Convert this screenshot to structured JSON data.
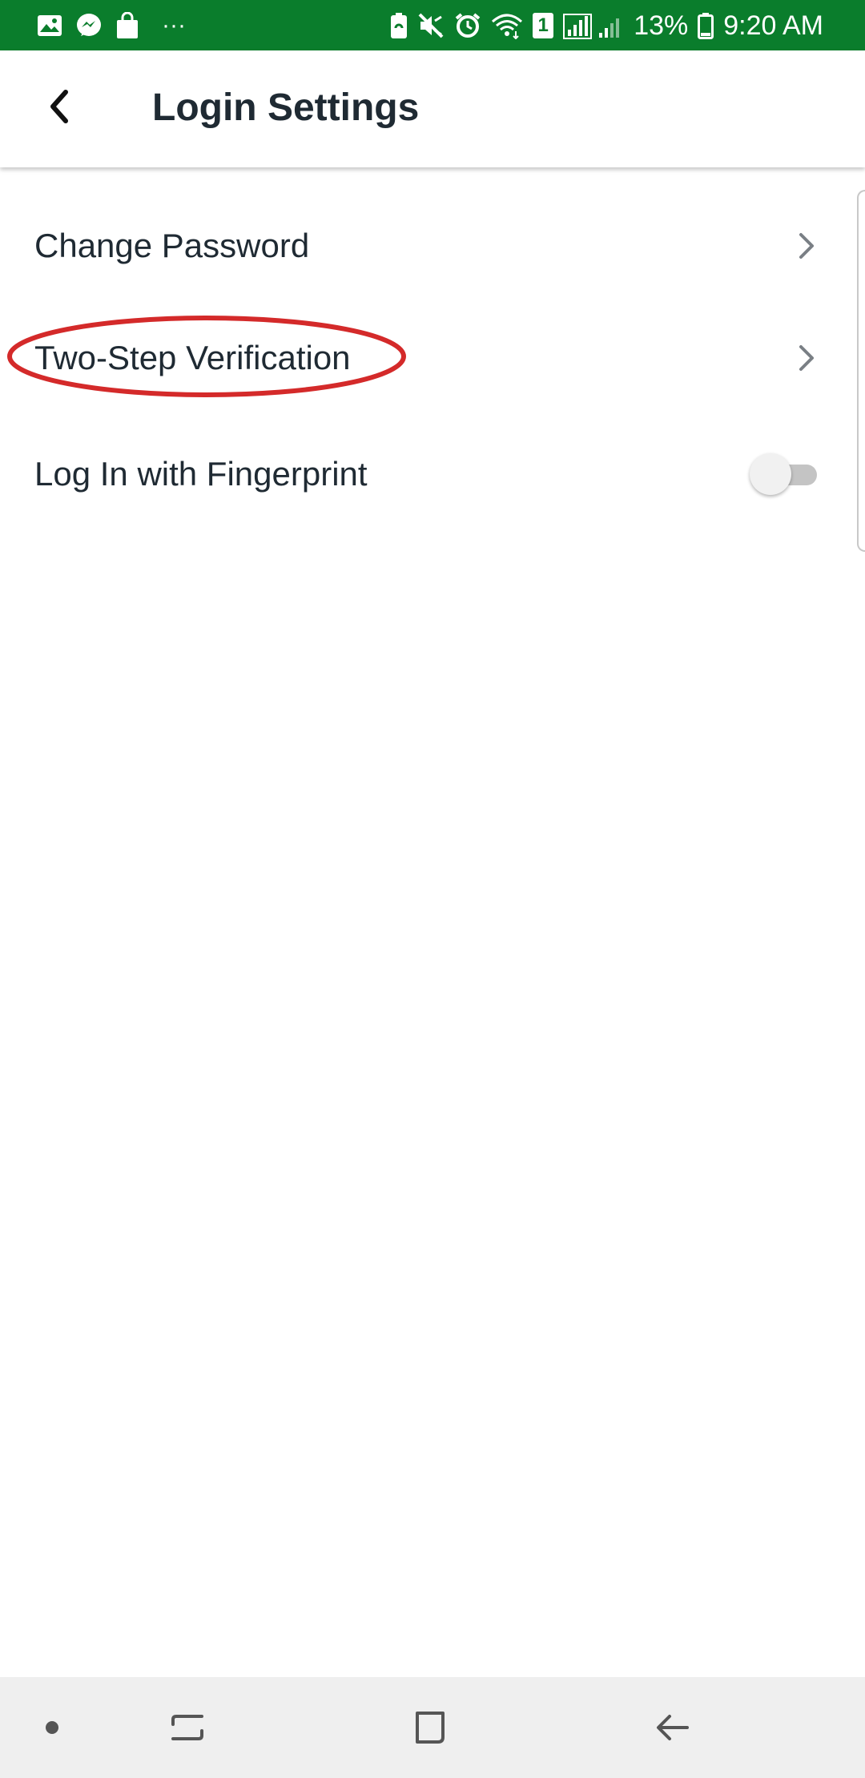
{
  "status_bar": {
    "battery_percent": "13%",
    "time": "9:20 AM",
    "more_indicator": "···",
    "sim_label": "1",
    "background_color": "#0a7d2c",
    "left_icons": [
      "gallery-icon",
      "messenger-icon",
      "shopping-bag-icon"
    ],
    "right_icons": [
      "battery-saver-icon",
      "mute-icon",
      "alarm-icon",
      "wifi-icon",
      "sim-icon",
      "signal-icon",
      "battery-icon"
    ]
  },
  "app_bar": {
    "title": "Login Settings",
    "back_icon": "back-arrow-icon"
  },
  "settings": {
    "items": [
      {
        "label": "Change Password",
        "control": "chevron-right-icon"
      },
      {
        "label": "Two-Step Verification",
        "control": "chevron-right-icon",
        "highlighted": true
      },
      {
        "label": "Log In with Fingerprint",
        "control": "toggle",
        "toggle_on": false
      }
    ]
  },
  "annotation": {
    "shape": "ellipse",
    "color": "#d42a2a"
  },
  "nav_bar": {
    "buttons": [
      "dot-icon",
      "recent-apps-icon",
      "home-icon",
      "back-icon"
    ]
  }
}
